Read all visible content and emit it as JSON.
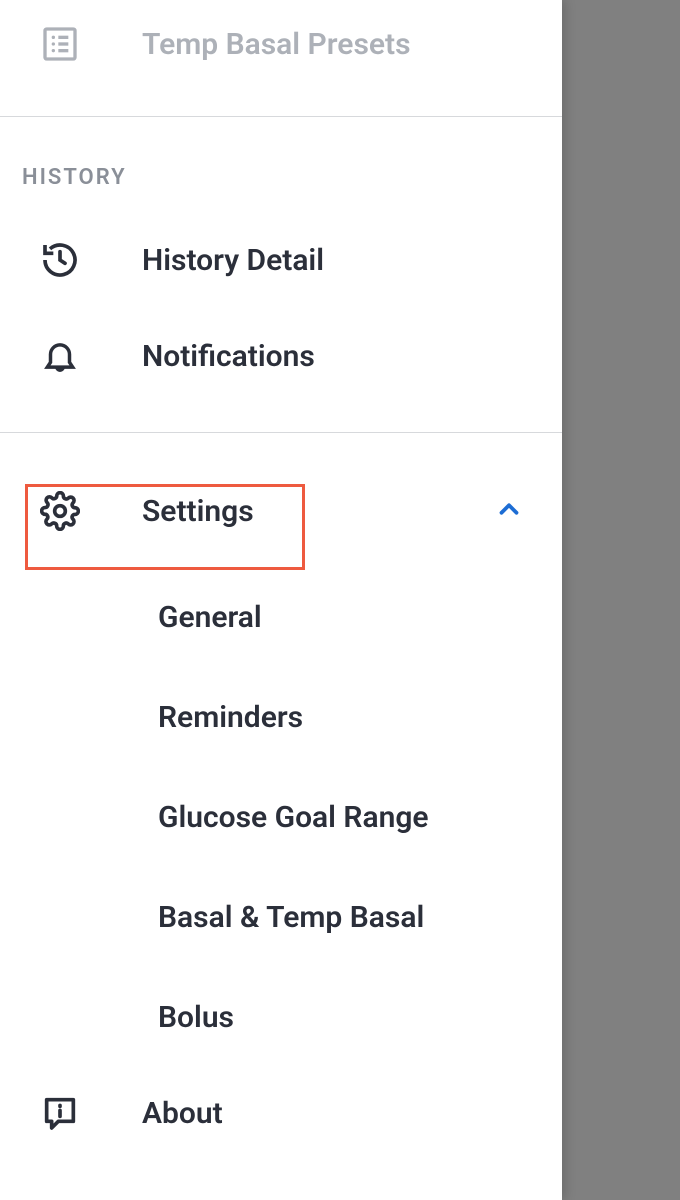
{
  "top_disabled": {
    "label": "Temp Basal Presets"
  },
  "sections": {
    "history": {
      "header": "HISTORY",
      "items": [
        {
          "label": "History Detail"
        },
        {
          "label": "Notifications"
        }
      ]
    },
    "settings": {
      "label": "Settings",
      "expanded": true,
      "children": [
        {
          "label": "General"
        },
        {
          "label": "Reminders"
        },
        {
          "label": "Glucose Goal Range"
        },
        {
          "label": "Basal & Temp Basal"
        },
        {
          "label": "Bolus"
        }
      ]
    },
    "about": {
      "label": "About"
    }
  },
  "highlight": {
    "target": "settings-row"
  }
}
